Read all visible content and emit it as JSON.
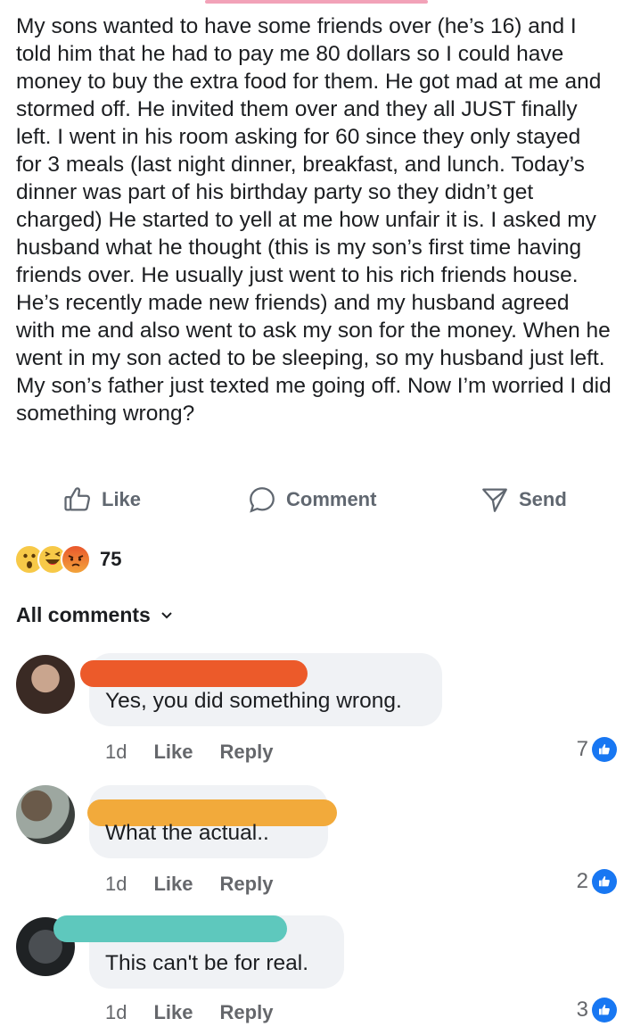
{
  "post": {
    "text": "My sons wanted to have some friends over (he’s 16) and I told him that he had to pay me 80 dollars so I could have money to buy the extra food for them. He got mad at me and stormed off. He invited them over and they all JUST finally left. I went in his room asking for 60 since they only stayed for 3 meals (last night dinner, breakfast, and lunch. Today’s dinner was part of his birthday party so they didn’t get charged) He started to yell at me how unfair it is. I asked my husband what he thought (this is my son’s first time having friends over. He usually just went to his rich friends house. He’s recently made new friends) and my husband agreed with me and also went to ask my son for the money. When he went in my son acted to be sleeping, so my husband just left. My son’s father just texted me going off. Now I’m worried I did something wrong?"
  },
  "actions": {
    "like": "Like",
    "comment": "Comment",
    "send": "Send"
  },
  "reactions": {
    "icons": [
      "wow-emoji",
      "haha-emoji",
      "angry-emoji"
    ],
    "count": "75"
  },
  "comments_header": "All comments",
  "comments": [
    {
      "text": "Yes, you did something wrong.",
      "time": "1d",
      "like": "Like",
      "reply": "Reply",
      "likes": "7",
      "redact_color": "#ec5a2a"
    },
    {
      "text": "What the actual..",
      "time": "1d",
      "like": "Like",
      "reply": "Reply",
      "likes": "2",
      "redact_color": "#f2aa3b"
    },
    {
      "text": "This can't be for real.",
      "time": "1d",
      "like": "Like",
      "reply": "Reply",
      "likes": "3",
      "redact_color": "#5ec8bd"
    }
  ]
}
